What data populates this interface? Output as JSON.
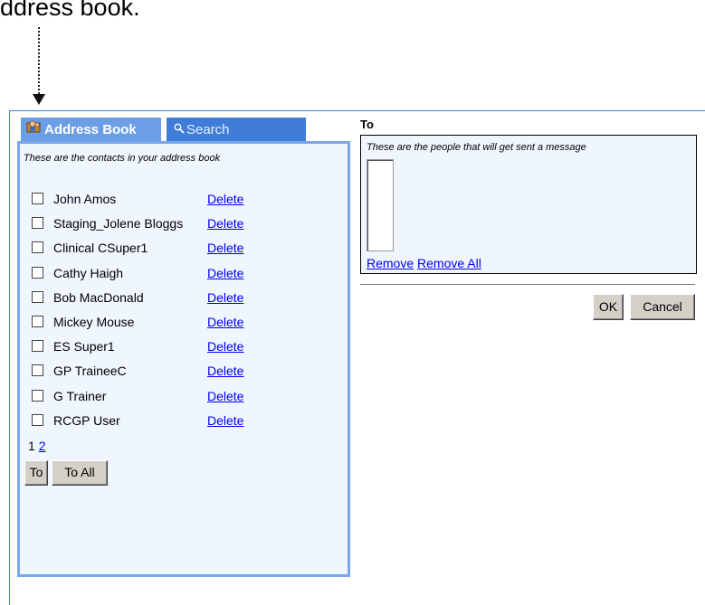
{
  "callout": {
    "text": "ddress book."
  },
  "tabs": {
    "address_book": "Address Book",
    "search": "Search"
  },
  "address_book": {
    "description": "These are the contacts in your address book",
    "delete_label": "Delete",
    "contacts": [
      {
        "name": "John Amos",
        "delete": "Delete"
      },
      {
        "name": "Staging_Jolene Bloggs",
        "delete": "Delete"
      },
      {
        "name": "Clinical CSuper1",
        "delete": "Delete"
      },
      {
        "name": "Cathy Haigh",
        "delete": "Delete"
      },
      {
        "name": "Bob MacDonald",
        "delete": "Delete"
      },
      {
        "name": "Mickey Mouse",
        "delete": "Delete"
      },
      {
        "name": "ES Super1",
        "delete": "Delete"
      },
      {
        "name": "GP TraineeC",
        "delete": "Delete"
      },
      {
        "name": "G Trainer",
        "delete": "Delete"
      },
      {
        "name": "RCGP User",
        "delete": "Delete"
      }
    ],
    "pager": {
      "current": "1",
      "next": "2"
    },
    "buttons": {
      "to": "To",
      "to_all": "To All"
    }
  },
  "to_panel": {
    "label": "To",
    "description": "These are the people that will get sent a message",
    "remove": "Remove",
    "remove_all": "Remove All"
  },
  "dialog_buttons": {
    "ok": "OK",
    "cancel": "Cancel"
  },
  "colors": {
    "tab_active": "#6b9ee6",
    "tab_inactive": "#3f7dd8",
    "panel_border": "#7aa7ec",
    "panel_bg": "#f0f6ff",
    "link": "#0000ee"
  }
}
